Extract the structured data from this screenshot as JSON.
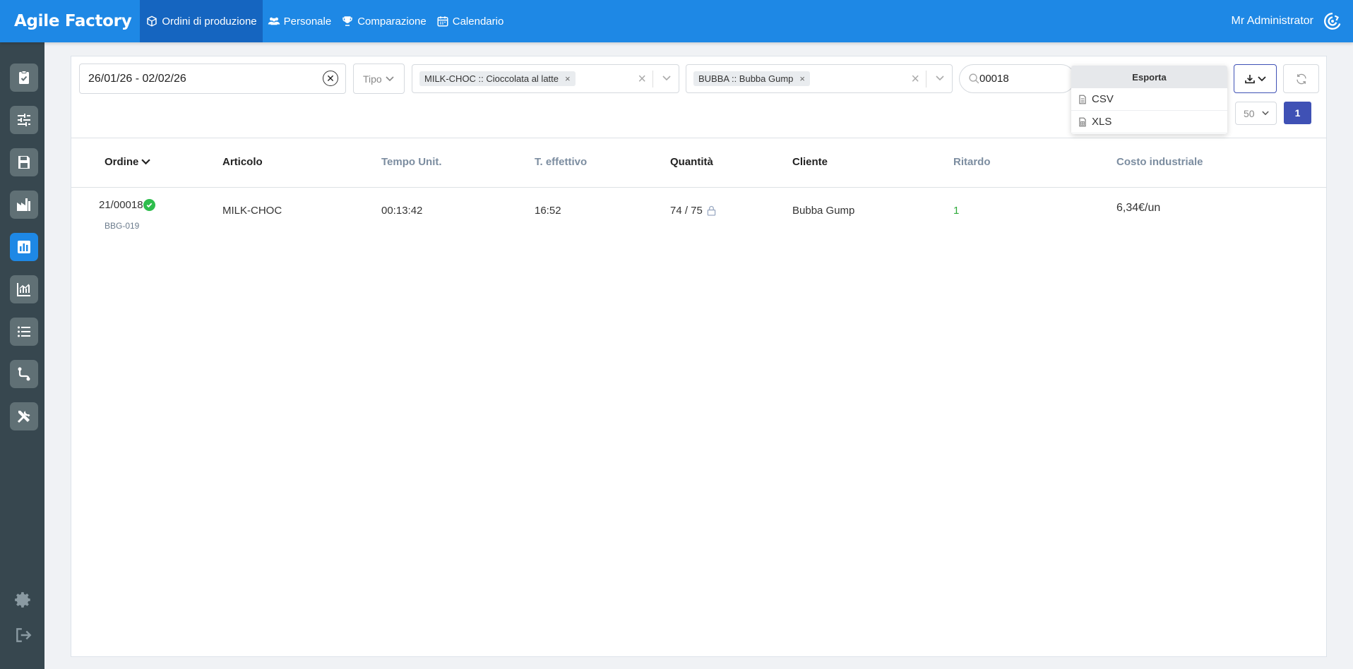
{
  "app": {
    "brand": "Agile Factory"
  },
  "nav": {
    "items": [
      {
        "label": "Ordini di produzione",
        "icon": "box-icon",
        "active": true
      },
      {
        "label": "Personale",
        "icon": "users-icon"
      },
      {
        "label": "Comparazione",
        "icon": "trophy-icon"
      },
      {
        "label": "Calendario",
        "icon": "calendar-icon"
      }
    ],
    "user": "Mr Administrator"
  },
  "sidebar": {
    "items": [
      "clipboard-check-icon",
      "sliders-icon",
      "save-icon",
      "factory-icon",
      "bar-chart-icon",
      "analytics-icon",
      "list-icon",
      "route-icon",
      "tools-icon"
    ],
    "active_index": 4,
    "bottom": [
      "gear-icon",
      "logout-icon"
    ]
  },
  "filters": {
    "date_range": "26/01/26 - 02/02/26",
    "tipo_placeholder": "Tipo",
    "article_tag": "MILK-CHOC :: Cioccolata al latte",
    "customer_tag": "BUBBA :: Bubba Gump",
    "search_value": "00018",
    "page_size": "50",
    "current_page": "1"
  },
  "export_menu": {
    "header": "Esporta",
    "options": [
      "CSV",
      "XLS"
    ]
  },
  "table": {
    "columns": [
      "Ordine",
      "Articolo",
      "Tempo Unit.",
      "T. effettivo",
      "Quantità",
      "Cliente",
      "Ritardo",
      "Costo industriale"
    ],
    "rows": [
      {
        "ordine": "21/00018",
        "codice": "BBG-019",
        "articolo": "MILK-CHOC",
        "tempo_unit": "00:13:42",
        "t_effettivo": "16:52",
        "quantita": "74 / 75",
        "cliente": "Bubba Gump",
        "ritardo": "1",
        "costo": "6,34€/un"
      }
    ]
  },
  "colors": {
    "primary": "#1e88e5",
    "sidebar": "#37474f",
    "accent": "#3f51b5",
    "success": "#2ebd4d"
  }
}
